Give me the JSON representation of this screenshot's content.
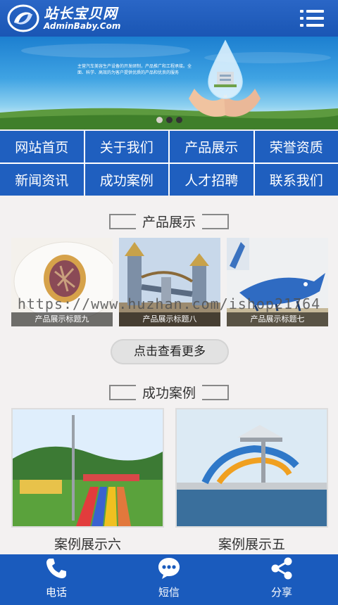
{
  "header": {
    "logo_title": "站长宝贝网",
    "logo_subtitle": "AdminBaby.Com"
  },
  "banner": {
    "text": "主营汽车美容生产设备的开发研制，产品推广和工程承接。全面、科学、高效的为客户提供优质的产品和优良的服务"
  },
  "nav": {
    "items": [
      {
        "label": "网站首页"
      },
      {
        "label": "关于我们"
      },
      {
        "label": "产品展示"
      },
      {
        "label": "荣誉资质"
      },
      {
        "label": "新闻资讯"
      },
      {
        "label": "成功案例"
      },
      {
        "label": "人才招聘"
      },
      {
        "label": "联系我们"
      }
    ]
  },
  "products": {
    "title": "产品展示",
    "items": [
      {
        "caption": "产品展示标题九"
      },
      {
        "caption": "产品展示标题八"
      },
      {
        "caption": "产品展示标题七"
      }
    ],
    "more_label": "点击查看更多"
  },
  "cases": {
    "title": "成功案例",
    "items": [
      {
        "caption": "案例展示六"
      },
      {
        "caption": "案例展示五"
      }
    ]
  },
  "watermark": "https://www.huzhan.com/ishop21764",
  "footer": {
    "items": [
      {
        "label": "电话",
        "icon": "phone-icon"
      },
      {
        "label": "短信",
        "icon": "message-icon"
      },
      {
        "label": "分享",
        "icon": "share-icon"
      }
    ]
  },
  "colors": {
    "primary": "#1f5fbf",
    "header": "#1a56b4",
    "background": "#f3f1f1"
  }
}
